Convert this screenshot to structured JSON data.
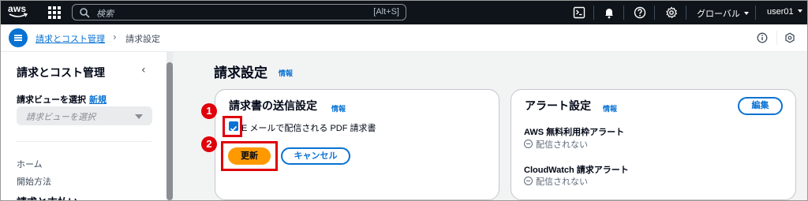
{
  "topbar": {
    "logo_text": "aws",
    "search_placeholder": "検索",
    "search_shortcut": "[Alt+S]",
    "region_label": "グローバル",
    "user_label": "user01"
  },
  "breadcrumb": {
    "parent": "請求とコスト管理",
    "current": "請求設定"
  },
  "sidebar": {
    "title": "請求とコスト管理",
    "view_label": "請求ビューを選択",
    "view_new_link": "新規",
    "view_select_placeholder": "請求ビューを選択",
    "items": [
      "ホーム",
      "開始方法"
    ],
    "section_title": "請求と支払い"
  },
  "main": {
    "page_title": "請求設定",
    "page_info_link": "情報",
    "invoice_card": {
      "title": "請求書の送信設定",
      "info_link": "情報",
      "checkbox_label": "E メールで配信される PDF 請求書",
      "checkbox_checked": true,
      "update_button": "更新",
      "cancel_button": "キャンセル"
    },
    "alert_card": {
      "title": "アラート設定",
      "info_link": "情報",
      "edit_button": "編集",
      "alerts": [
        {
          "name": "AWS 無料利用枠アラート",
          "status": "配信されない"
        },
        {
          "name": "CloudWatch 請求アラート",
          "status": "配信されない"
        }
      ]
    }
  },
  "annotations": {
    "step1": "1",
    "step2": "2",
    "highlight_color": "#e0000b"
  },
  "colors": {
    "accent": "#0972d3",
    "primary_button": "#ff9900",
    "topbar": "#0f141a"
  }
}
